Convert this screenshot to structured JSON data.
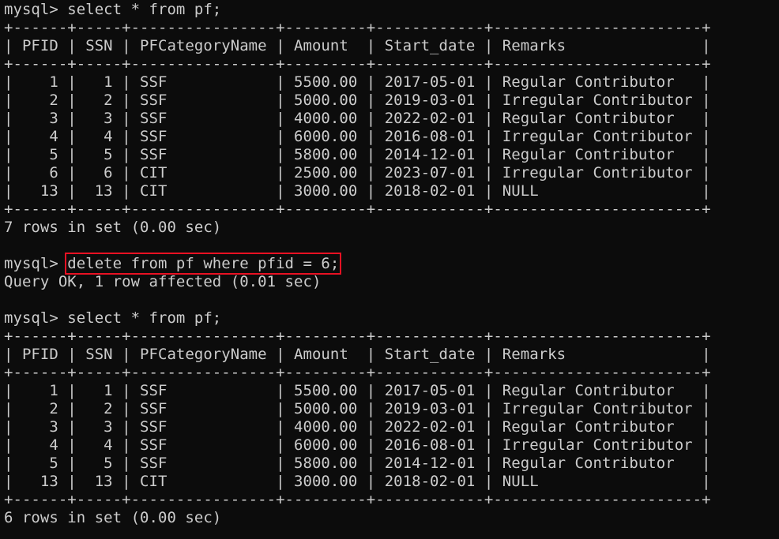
{
  "terminal": {
    "block1": {
      "prompt": "mysql> ",
      "command": "select * from pf;",
      "table": {
        "border": "+------+-----+----------------+---------+------------+-----------------------+",
        "header": "| PFID | SSN | PFCategoryName | Amount  | Start_date | Remarks               |",
        "rows": [
          "|    1 |   1 | SSF            | 5500.00 | 2017-05-01 | Regular Contributor   |",
          "|    2 |   2 | SSF            | 5000.00 | 2019-03-01 | Irregular Contributor |",
          "|    3 |   3 | SSF            | 4000.00 | 2022-02-01 | Regular Contributor   |",
          "|    4 |   4 | SSF            | 6000.00 | 2016-08-01 | Irregular Contributor |",
          "|    5 |   5 | SSF            | 5800.00 | 2014-12-01 | Regular Contributor   |",
          "|    6 |   6 | CIT            | 2500.00 | 2023-07-01 | Irregular Contributor |",
          "|   13 |  13 | CIT            | 3000.00 | 2018-02-01 | NULL                  |"
        ]
      },
      "summary": "7 rows in set (0.00 sec)"
    },
    "block2": {
      "prompt": "mysql> ",
      "command": "delete from pf where pfid = 6;",
      "result": "Query OK, 1 row affected (0.01 sec)"
    },
    "block3": {
      "prompt": "mysql> ",
      "command": "select * from pf;",
      "table": {
        "border": "+------+-----+----------------+---------+------------+-----------------------+",
        "header": "| PFID | SSN | PFCategoryName | Amount  | Start_date | Remarks               |",
        "rows": [
          "|    1 |   1 | SSF            | 5500.00 | 2017-05-01 | Regular Contributor   |",
          "|    2 |   2 | SSF            | 5000.00 | 2019-03-01 | Irregular Contributor |",
          "|    3 |   3 | SSF            | 4000.00 | 2022-02-01 | Regular Contributor   |",
          "|    4 |   4 | SSF            | 6000.00 | 2016-08-01 | Irregular Contributor |",
          "|    5 |   5 | SSF            | 5800.00 | 2014-12-01 | Regular Contributor   |",
          "|   13 |  13 | CIT            | 3000.00 | 2018-02-01 | NULL                  |"
        ]
      },
      "summary": "6 rows in set (0.00 sec)"
    },
    "colors": {
      "background": "#0c0c0c",
      "text": "#cccccc",
      "highlight": "#e81123"
    }
  }
}
